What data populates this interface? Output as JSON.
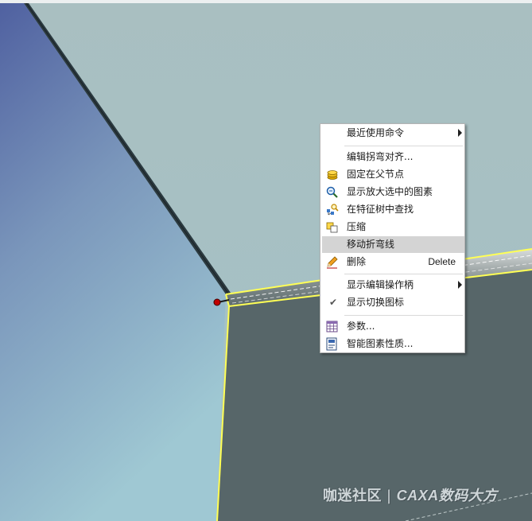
{
  "context_menu": {
    "items": [
      {
        "label": "最近使用命令",
        "icon": "",
        "submenu": true
      },
      {
        "label": "编辑拐弯对齐...",
        "icon": ""
      },
      {
        "label": "固定在父节点",
        "icon": "pin-stack-icon"
      },
      {
        "label": "显示放大选中的图素",
        "icon": "zoom-selection-icon"
      },
      {
        "label": "在特征树中查找",
        "icon": "feature-tree-search-icon"
      },
      {
        "label": "压缩",
        "icon": "compress-icon"
      },
      {
        "label": "移动折弯线",
        "icon": "",
        "highlighted": true
      },
      {
        "label": "删除",
        "icon": "pencil-delete-icon",
        "shortcut": "Delete"
      },
      {
        "label": "显示编辑操作柄",
        "icon": "",
        "submenu": true
      },
      {
        "label": "显示切换图标",
        "icon": "checkmark-icon",
        "checked": true
      },
      {
        "label": "参数...",
        "icon": "parameters-table-icon"
      },
      {
        "label": "智能图素性质...",
        "icon": "properties-icon"
      }
    ]
  },
  "watermark": {
    "left": "咖迷社区",
    "separator": "|",
    "right": "CAXA数码大方"
  },
  "colors": {
    "selection_highlight": "#ffff55",
    "menu_hover": "#d4d4d4",
    "handle_red": "#c00000"
  }
}
